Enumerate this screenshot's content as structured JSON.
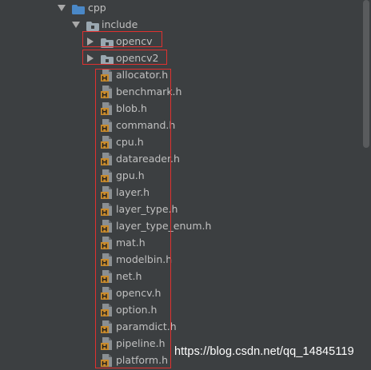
{
  "project_tree": {
    "root": {
      "label": "cpp",
      "expanded": true,
      "icon": "folder-icon"
    },
    "include": {
      "label": "include",
      "expanded": true,
      "icon": "package-folder-icon"
    },
    "subfolders": [
      {
        "label": "opencv",
        "expanded": false,
        "icon": "package-folder-icon"
      },
      {
        "label": "opencv2",
        "expanded": false,
        "icon": "package-folder-icon"
      }
    ],
    "files": [
      {
        "label": "allocator.h",
        "icon": "header-file-icon"
      },
      {
        "label": "benchmark.h",
        "icon": "header-file-icon"
      },
      {
        "label": "blob.h",
        "icon": "header-file-icon"
      },
      {
        "label": "command.h",
        "icon": "header-file-icon"
      },
      {
        "label": "cpu.h",
        "icon": "header-file-icon"
      },
      {
        "label": "datareader.h",
        "icon": "header-file-icon"
      },
      {
        "label": "gpu.h",
        "icon": "header-file-icon"
      },
      {
        "label": "layer.h",
        "icon": "header-file-icon"
      },
      {
        "label": "layer_type.h",
        "icon": "header-file-icon"
      },
      {
        "label": "layer_type_enum.h",
        "icon": "header-file-icon"
      },
      {
        "label": "mat.h",
        "icon": "header-file-icon"
      },
      {
        "label": "modelbin.h",
        "icon": "header-file-icon"
      },
      {
        "label": "net.h",
        "icon": "header-file-icon"
      },
      {
        "label": "opencv.h",
        "icon": "header-file-icon"
      },
      {
        "label": "option.h",
        "icon": "header-file-icon"
      },
      {
        "label": "paramdict.h",
        "icon": "header-file-icon"
      },
      {
        "label": "pipeline.h",
        "icon": "header-file-icon"
      },
      {
        "label": "platform.h",
        "icon": "header-file-icon"
      }
    ]
  },
  "watermark": "https://blog.csdn.net/qq_14845119",
  "colors": {
    "background": "#3c3f41",
    "highlight_border": "#e0312f",
    "folder_blue": "#4a88c7",
    "package_gray": "#9aa7b0",
    "header_file_orange": "#c98b2c",
    "text": "#c0c0c0"
  }
}
